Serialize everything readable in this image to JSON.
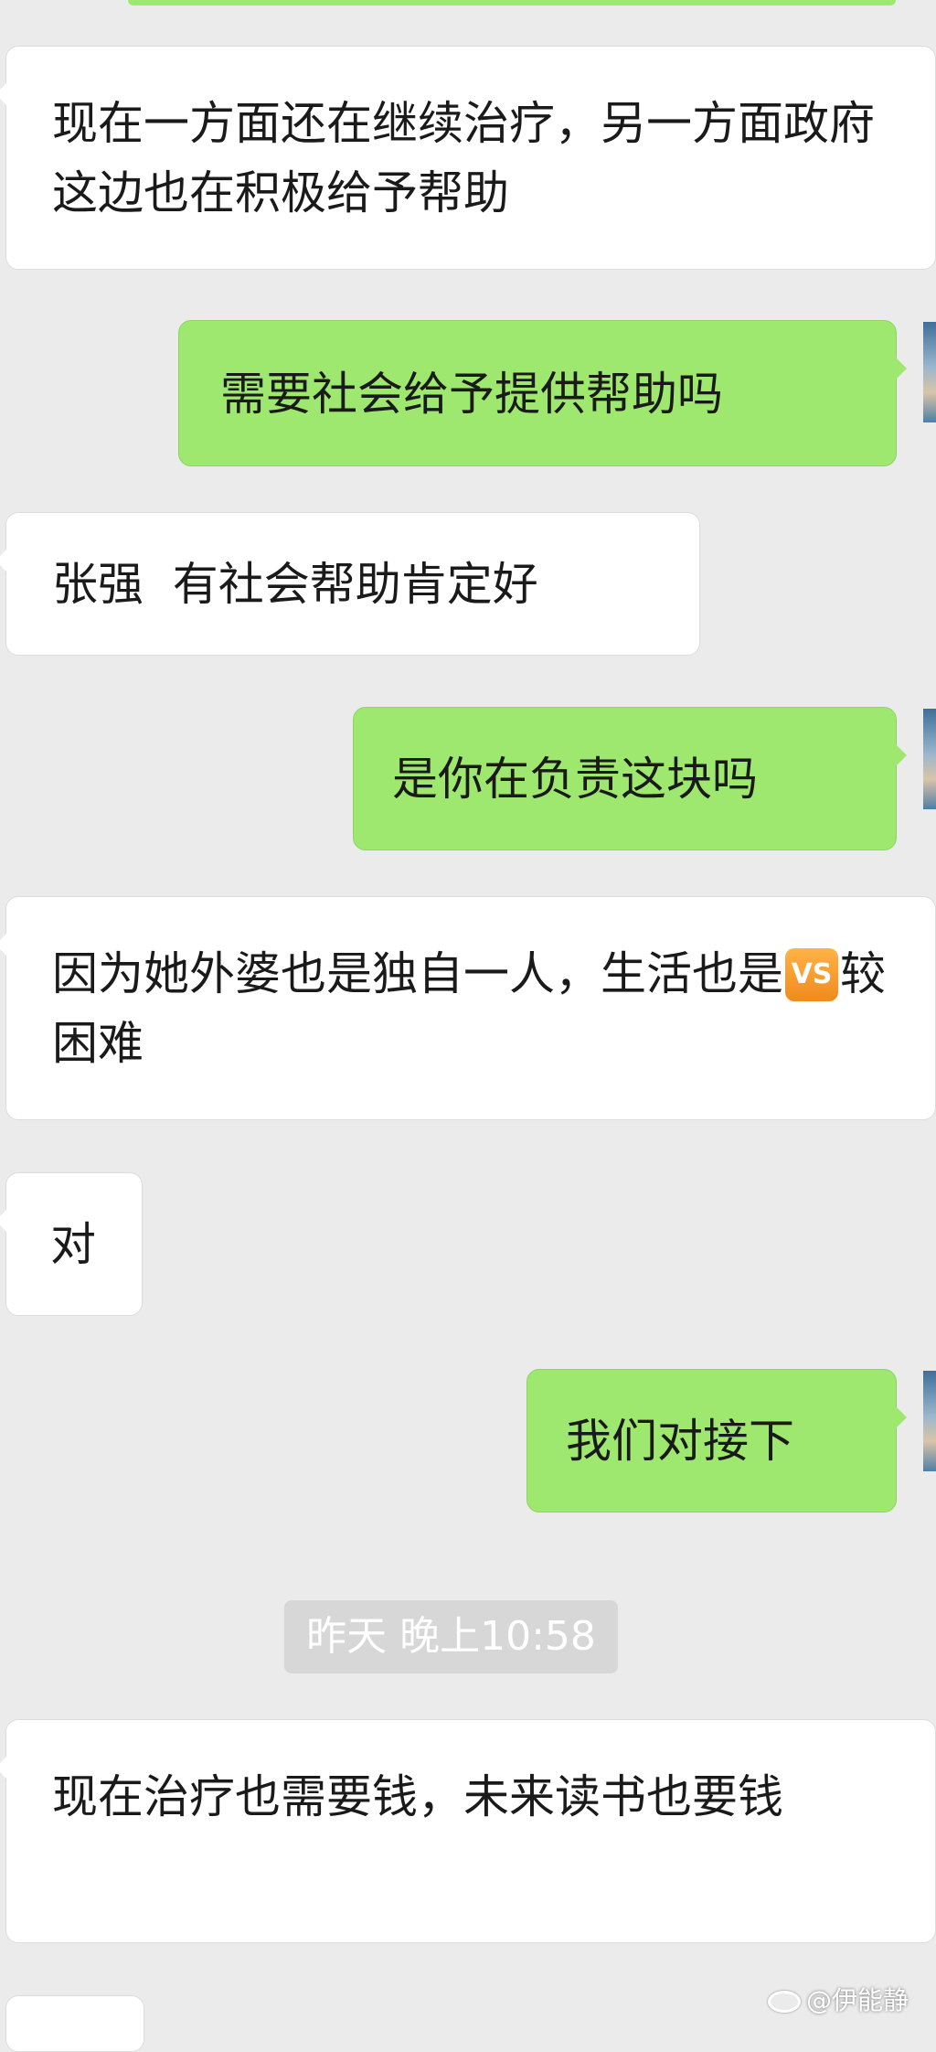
{
  "messages": [
    {
      "id": "m1",
      "side": "in",
      "text": "现在一方面还在继续治疗，另一方面政府这边也在积极给予帮助"
    },
    {
      "id": "m2",
      "side": "out",
      "text": "需要社会给予提供帮助吗"
    },
    {
      "id": "m3",
      "side": "in",
      "text": "张强  有社会帮助肯定好"
    },
    {
      "id": "m4",
      "side": "out",
      "text": "是你在负责这块吗"
    },
    {
      "id": "m5",
      "side": "in",
      "text_before": "因为她外婆也是独自一人，生活也是",
      "emoji": "VS",
      "text_after": "较困难"
    },
    {
      "id": "m6",
      "side": "in",
      "text": "对"
    },
    {
      "id": "m7",
      "side": "out",
      "text": "我们对接下"
    },
    {
      "id": "m8",
      "side": "in",
      "text": "现在治疗也需要钱，未来读书也要钱"
    }
  ],
  "timestamp": "昨天 晚上10:58",
  "watermark": "@伊能静",
  "colors": {
    "incoming": "#ffffff",
    "outgoing": "#9fe870",
    "background": "#ebebeb",
    "timestamp_bg": "#d7d7d7"
  }
}
